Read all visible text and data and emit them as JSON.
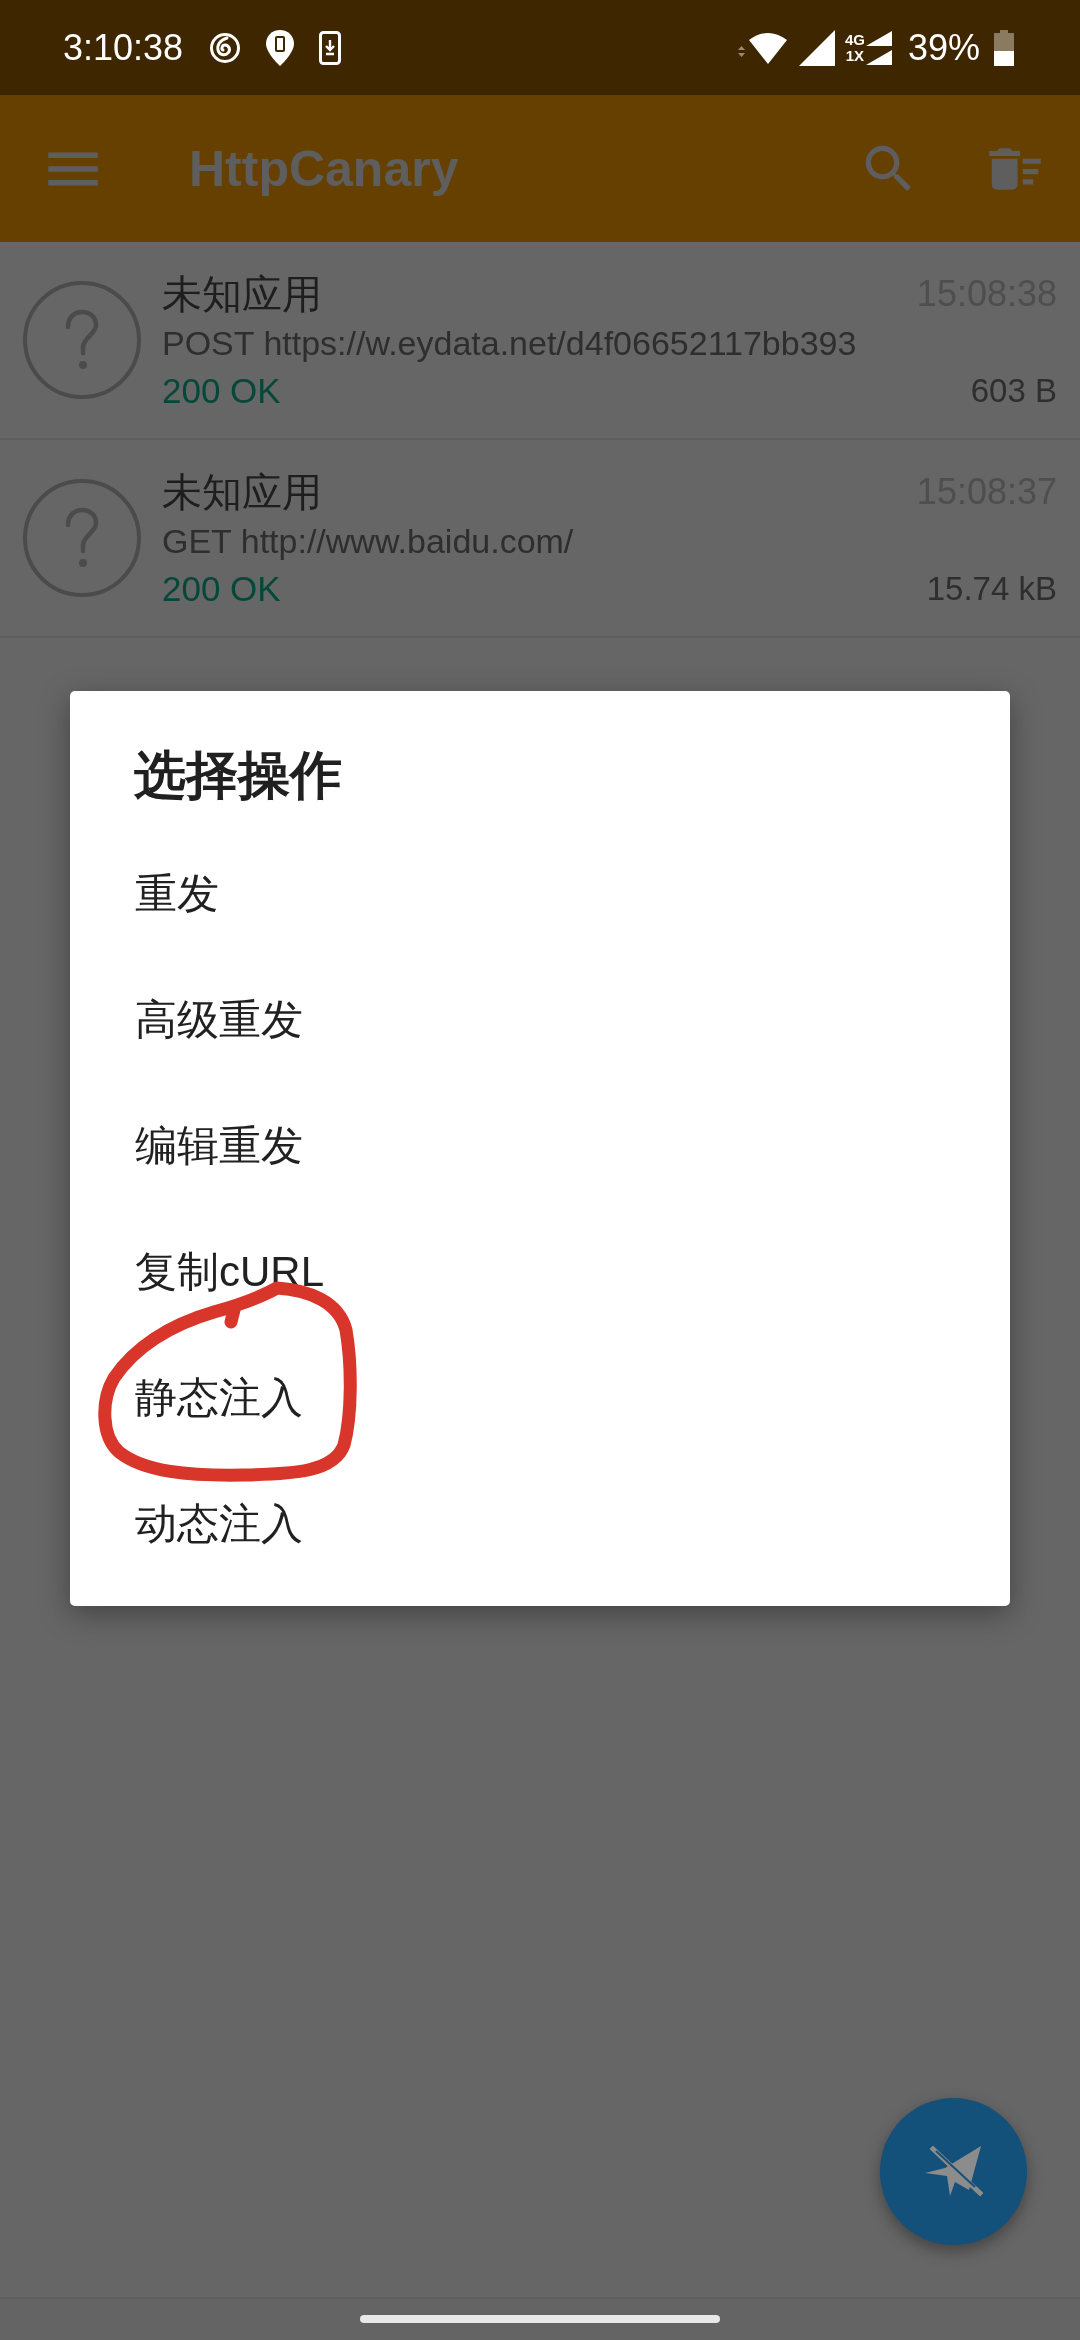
{
  "status_bar": {
    "time": "3:10:38",
    "network_types": [
      "4G",
      "1X"
    ],
    "battery": "39%"
  },
  "app_bar": {
    "title": "HttpCanary"
  },
  "requests": [
    {
      "app": "未知应用",
      "time": "15:08:38",
      "request": "POST https://w.eydata.net/d4f06652117bb393",
      "status": "200 OK",
      "size": "603 B"
    },
    {
      "app": "未知应用",
      "time": "15:08:37",
      "request": "GET http://www.baidu.com/",
      "status": "200 OK",
      "size": "15.74 kB"
    }
  ],
  "dialog": {
    "title": "选择操作",
    "options": [
      {
        "label": "重发",
        "circled": false
      },
      {
        "label": "高级重发",
        "circled": false
      },
      {
        "label": "编辑重发",
        "circled": false
      },
      {
        "label": "复制cURL",
        "circled": false
      },
      {
        "label": "静态注入",
        "circled": true
      },
      {
        "label": "动态注入",
        "circled": false
      }
    ]
  }
}
